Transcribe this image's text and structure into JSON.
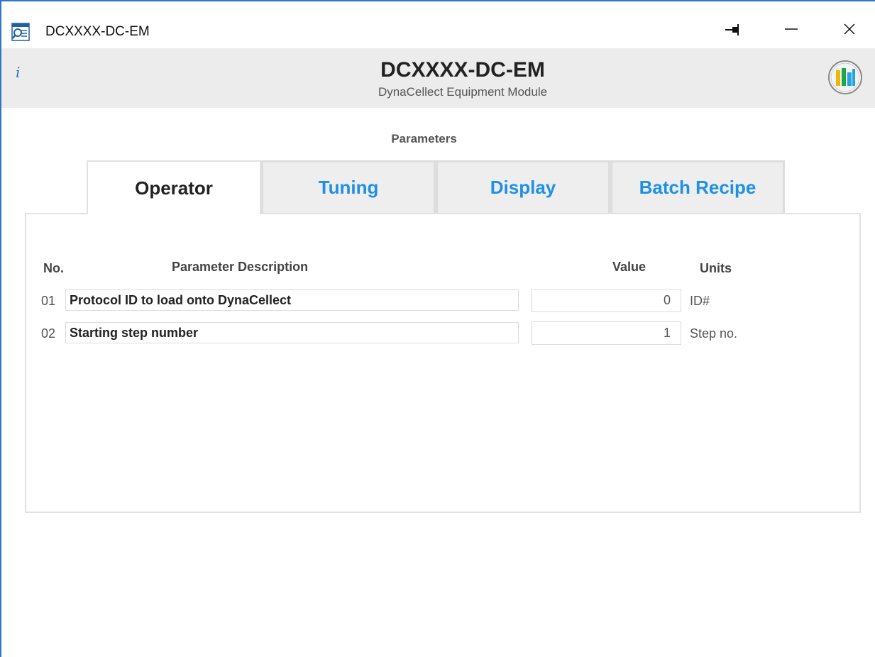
{
  "window": {
    "title": "DCXXXX-DC-EM",
    "icons": [
      "app-icon",
      "pin-icon",
      "minimize-icon",
      "close-icon"
    ]
  },
  "header": {
    "info_icon": "i",
    "title": "DCXXXX-DC-EM",
    "subtitle": "DynaCellect Equipment Module",
    "logo_colors": [
      "#f2b705",
      "#1aa84c",
      "#27a3e0"
    ]
  },
  "section": {
    "title": "Parameters"
  },
  "tabs": [
    {
      "label": "Operator",
      "active": true
    },
    {
      "label": "Tuning",
      "active": false
    },
    {
      "label": "Display",
      "active": false
    },
    {
      "label": "Batch Recipe",
      "active": false
    }
  ],
  "table": {
    "headers": {
      "no": "No.",
      "description": "Parameter Description",
      "value": "Value",
      "units": "Units"
    },
    "rows": [
      {
        "no": "01",
        "description": "Protocol ID to load onto DynaCellect",
        "value": "0",
        "units": "ID#"
      },
      {
        "no": "02",
        "description": "Starting step number",
        "value": "1",
        "units": "Step no."
      }
    ]
  },
  "colors": {
    "accent": "#1e90e6",
    "frame": "#2b78c5",
    "header_bg": "#ececec"
  }
}
